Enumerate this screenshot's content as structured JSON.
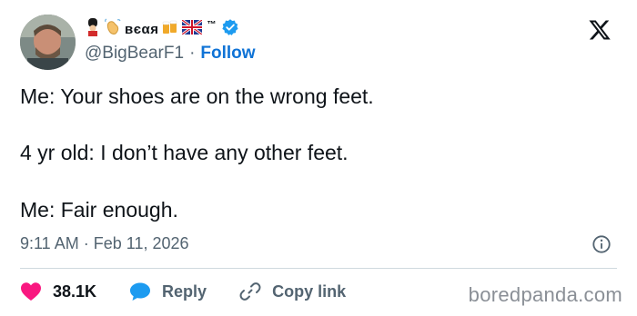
{
  "user": {
    "display_name": "вєαя",
    "display_name_emojis_left": [
      "guard-emoji",
      "waving-hand-emoji"
    ],
    "display_name_emojis_right": [
      "beer-mugs-emoji",
      "uk-flag-emoji"
    ],
    "trademark": "™",
    "handle": "@BigBearF1",
    "separator": "·",
    "follow_label": "Follow",
    "verified": true
  },
  "tweet": {
    "lines": [
      "Me: Your shoes are on the wrong feet.",
      "4 yr old: I don’t have any other feet.",
      "Me: Fair enough."
    ],
    "time": "9:11 AM",
    "separator": "·",
    "date": "Feb 11, 2026"
  },
  "actions": {
    "likes": "38.1K",
    "reply_label": "Reply",
    "copy_link_label": "Copy link"
  },
  "watermark": "boredpanda.com",
  "colors": {
    "accent": "#1d9bf0",
    "like": "#f91880",
    "text": "#0f1419",
    "muted": "#536471"
  }
}
